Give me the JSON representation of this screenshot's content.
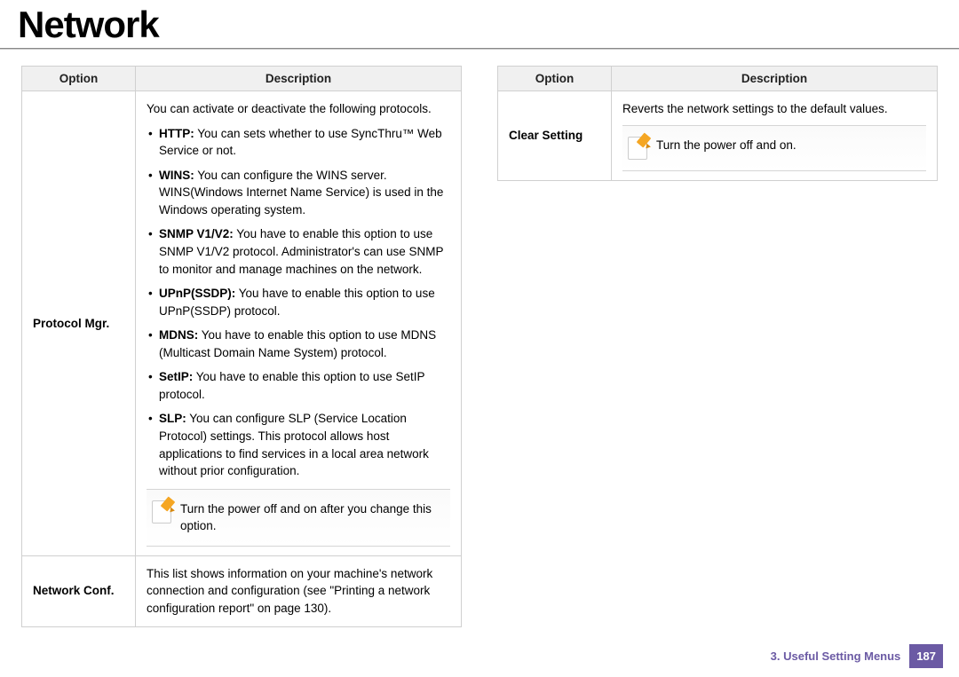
{
  "title": "Network",
  "headers": {
    "option": "Option",
    "description": "Description"
  },
  "left": {
    "rows": [
      {
        "option": "Protocol Mgr.",
        "intro": "You can activate or deactivate the following protocols.",
        "bullets": [
          {
            "name": "HTTP:",
            "text": "  You can sets whether to use SyncThru™ Web Service or not."
          },
          {
            "name": "WINS:",
            "text": "  You can configure the WINS server. WINS(Windows Internet Name Service) is used in the Windows operating system."
          },
          {
            "name": "SNMP V1/V2:",
            "text": " You have to enable this option to use SNMP V1/V2 protocol. Administrator's can use SNMP to monitor and manage machines on the network."
          },
          {
            "name": "UPnP(SSDP):",
            "text": " You have to enable this option to use UPnP(SSDP) protocol."
          },
          {
            "name": "MDNS:",
            "text": " You have to enable this option to use MDNS (Multicast Domain Name System) protocol."
          },
          {
            "name": "SetIP:",
            "text": " You have to enable this option to use SetIP protocol."
          },
          {
            "name": "SLP:",
            "text": " You can configure SLP (Service Location Protocol) settings. This protocol allows host applications to find services in a local area network without prior configuration."
          }
        ],
        "note": "Turn the power off and on after you change this option."
      },
      {
        "option": "Network Conf.",
        "desc": "This list shows information on your machine's network connection and configuration (see \"Printing a network configuration report\" on page 130)."
      }
    ]
  },
  "right": {
    "rows": [
      {
        "option": "Clear Setting",
        "desc": "Reverts the network settings to the default values.",
        "note": "Turn the power off and on."
      }
    ]
  },
  "footer": {
    "chapter": "3.  Useful Setting Menus",
    "page": "187"
  }
}
